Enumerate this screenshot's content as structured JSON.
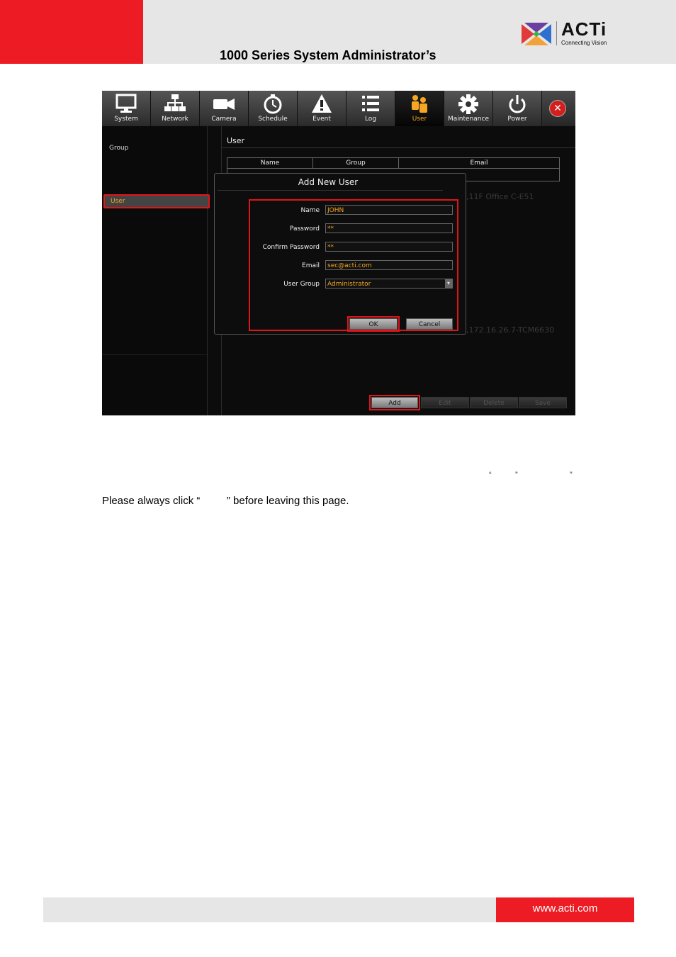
{
  "header": {
    "title": "1000 Series System Administrator’s",
    "logo_name": "ACTi",
    "logo_tagline": "Connecting Vision"
  },
  "app": {
    "tabs": [
      {
        "label": "System",
        "icon": "monitor-icon"
      },
      {
        "label": "Network",
        "icon": "network-icon"
      },
      {
        "label": "Camera",
        "icon": "camera-icon"
      },
      {
        "label": "Schedule",
        "icon": "clock-icon"
      },
      {
        "label": "Event",
        "icon": "warning-icon"
      },
      {
        "label": "Log",
        "icon": "list-icon"
      },
      {
        "label": "User",
        "icon": "users-icon"
      },
      {
        "label": "Maintenance",
        "icon": "gear-icon"
      },
      {
        "label": "Power",
        "icon": "power-icon"
      }
    ],
    "active_tab": "User",
    "close_icon": "close-icon",
    "sidebar": {
      "group_label": "Group",
      "user_label": "User"
    },
    "main_title": "User",
    "table_headers": [
      "Name",
      "Group",
      "Email"
    ],
    "ghost_text_1": ",11F Office C-E51",
    "ghost_text_2": ",172.16.26.7-TCM6630",
    "bottom_buttons": {
      "add": "Add",
      "edit": "Edit",
      "delete": "Delete",
      "save": "Save"
    },
    "dialog": {
      "title": "Add New User",
      "name_label": "Name",
      "name_value": "JOHN",
      "password_label": "Password",
      "password_value": "**",
      "confirm_label": "Confirm Password",
      "confirm_value": "**",
      "email_label": "Email",
      "email_value": "sec@acti.com",
      "group_label": "User Group",
      "group_value": "Administrator",
      "ok": "OK",
      "cancel": "Cancel"
    },
    "accent_color": "#f5a623",
    "highlight_color": "#e0141b"
  },
  "doc": {
    "quote_open": "“",
    "quote_close": "”",
    "quote_close_2": "”",
    "sentence": "Please always click “         ” before leaving this page."
  },
  "footer": {
    "url": "www.acti.com"
  }
}
